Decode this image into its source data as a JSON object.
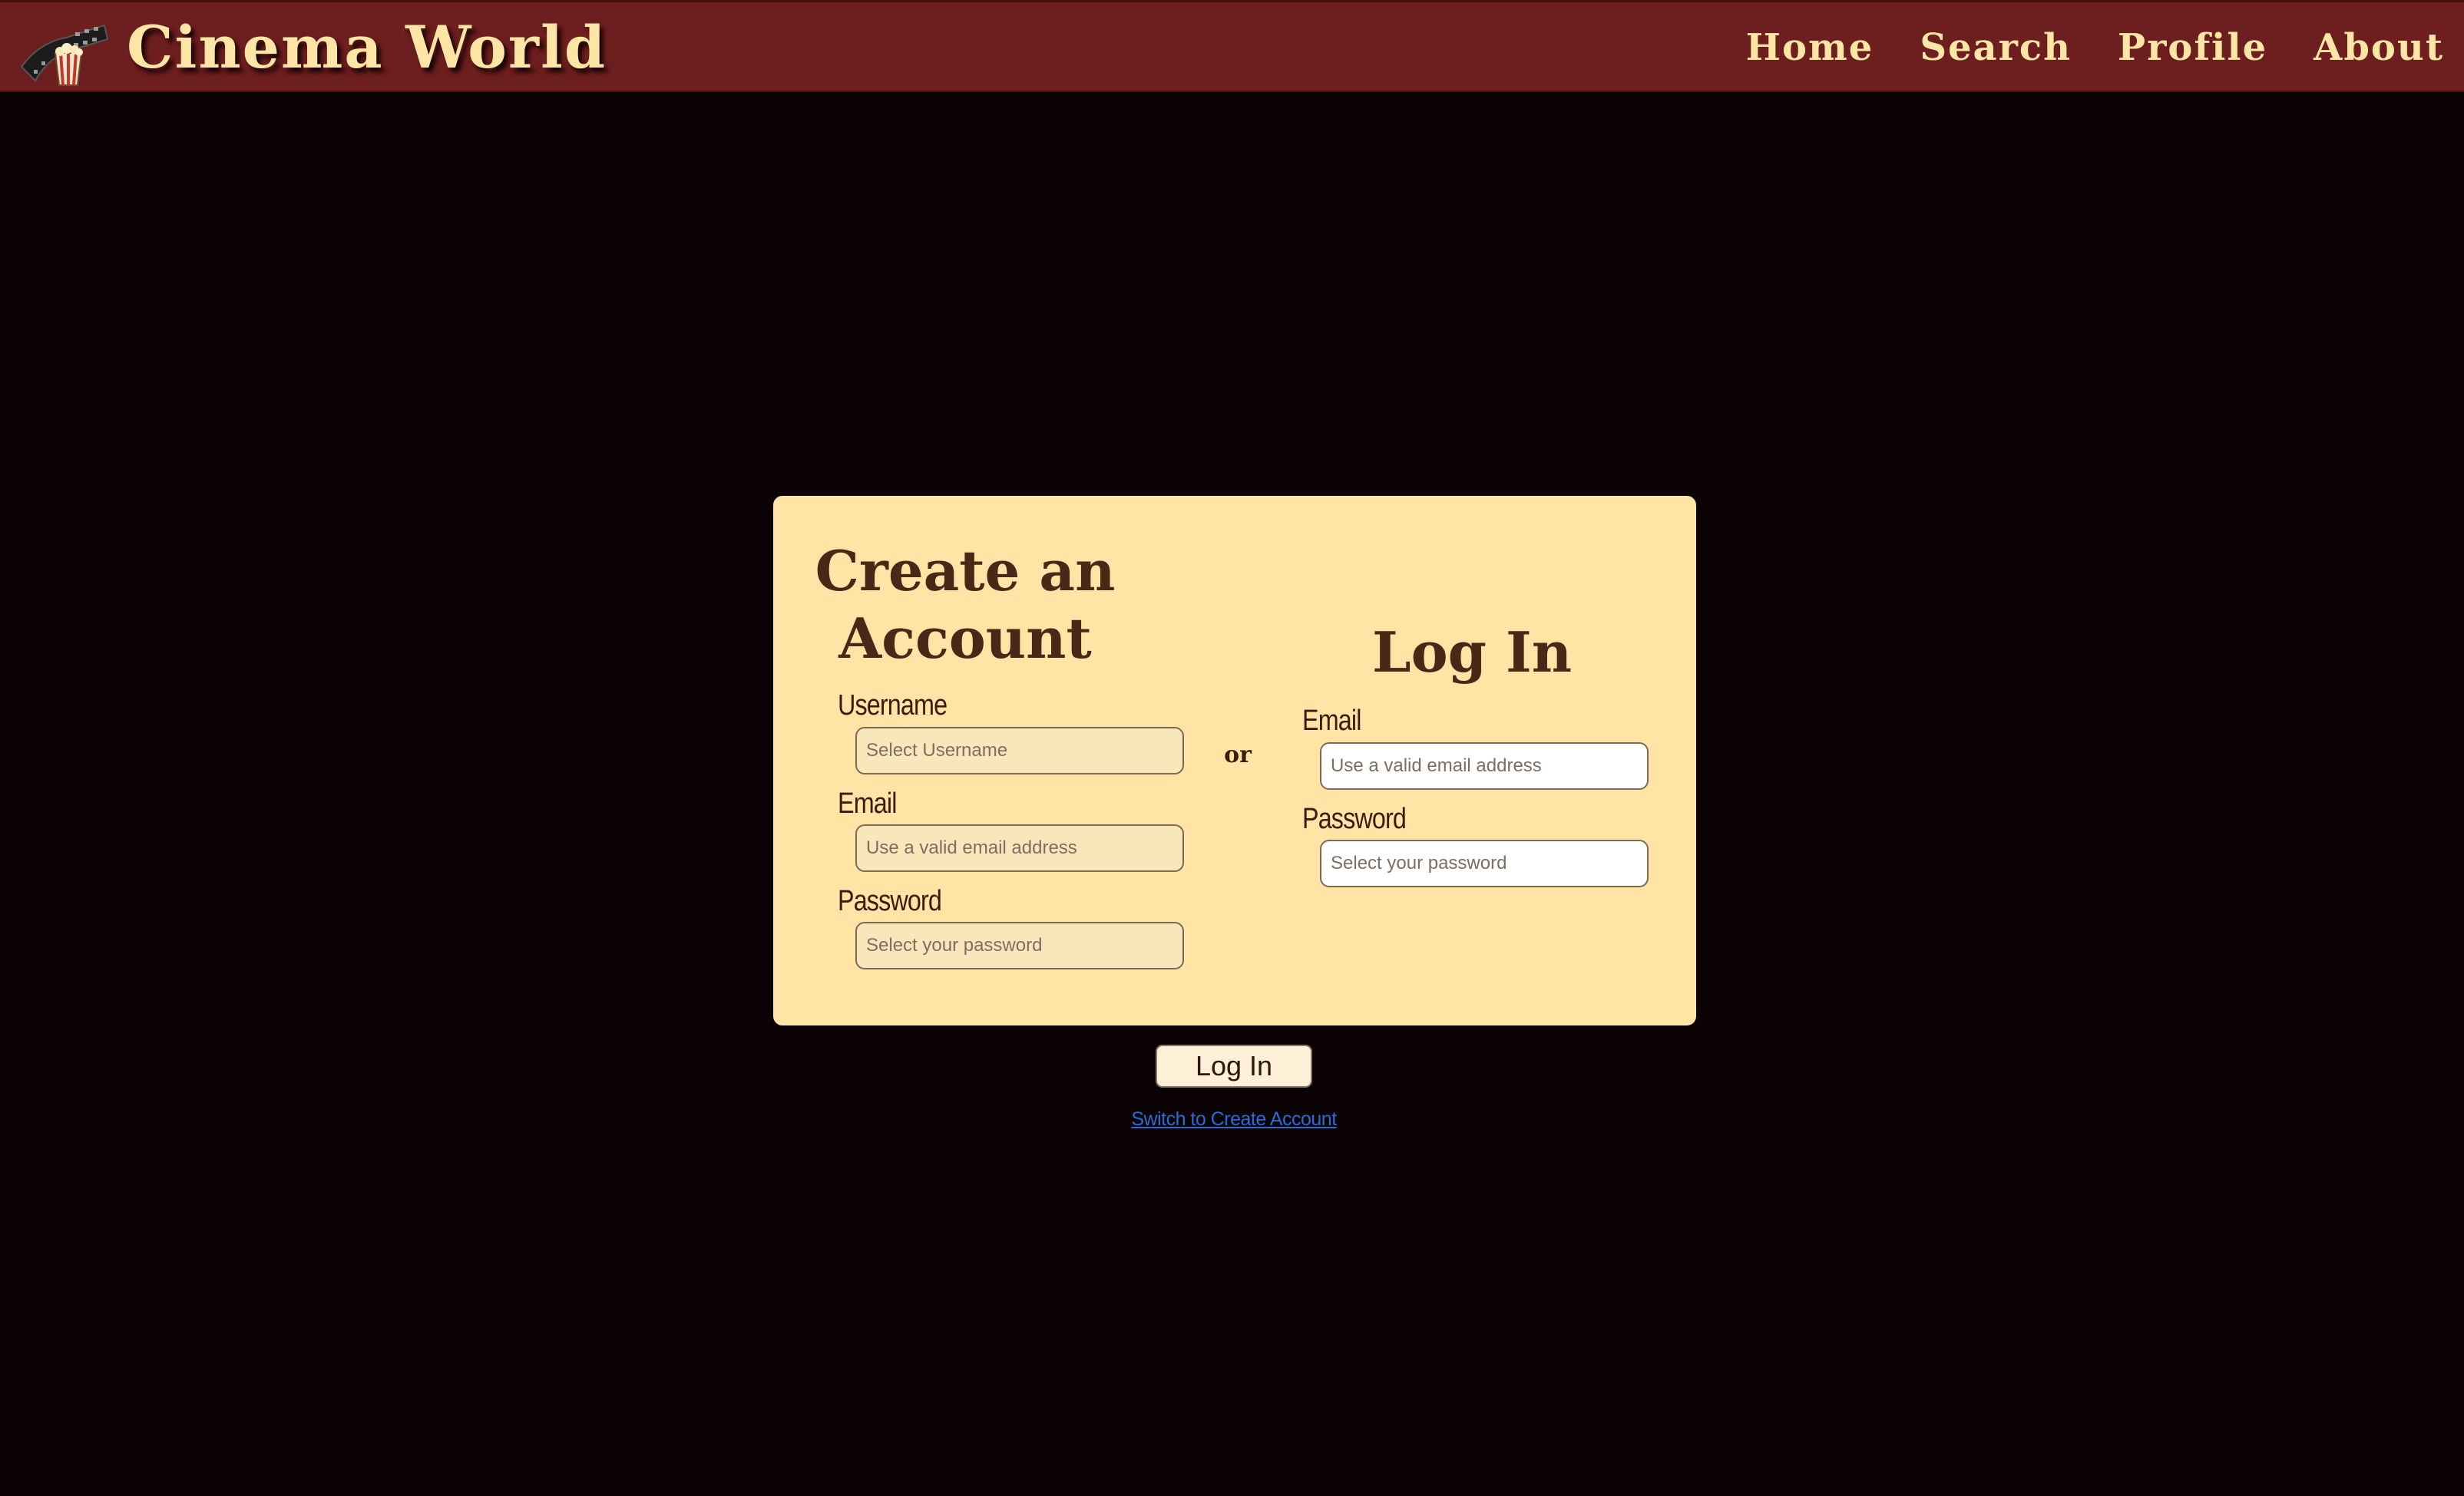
{
  "header": {
    "brand": "Cinema World",
    "logo_icon": "film-reel-popcorn-icon",
    "nav": [
      "Home",
      "Search",
      "Profile",
      "About"
    ]
  },
  "create_account": {
    "title": "Create an Account",
    "fields": [
      {
        "label": "Username",
        "placeholder": "Select Username",
        "value": ""
      },
      {
        "label": "Email",
        "placeholder": "Use a valid email address",
        "value": ""
      },
      {
        "label": "Password",
        "placeholder": "Select your password",
        "value": ""
      }
    ]
  },
  "separator": "or",
  "login": {
    "title": "Log In",
    "fields": [
      {
        "label": "Email",
        "placeholder": "Use a valid email address",
        "value": ""
      },
      {
        "label": "Password",
        "placeholder": "Select your password",
        "value": ""
      }
    ]
  },
  "actions": {
    "submit_label": "Log In",
    "switch_link": "Switch to Create Account"
  },
  "colors": {
    "header_bg": "#6d1e1e",
    "page_bg": "#0b0303",
    "card_bg": "#ffe4a6",
    "title_text": "#4a2716",
    "accent_text": "#fde5a6",
    "link": "#2a6bd8"
  }
}
